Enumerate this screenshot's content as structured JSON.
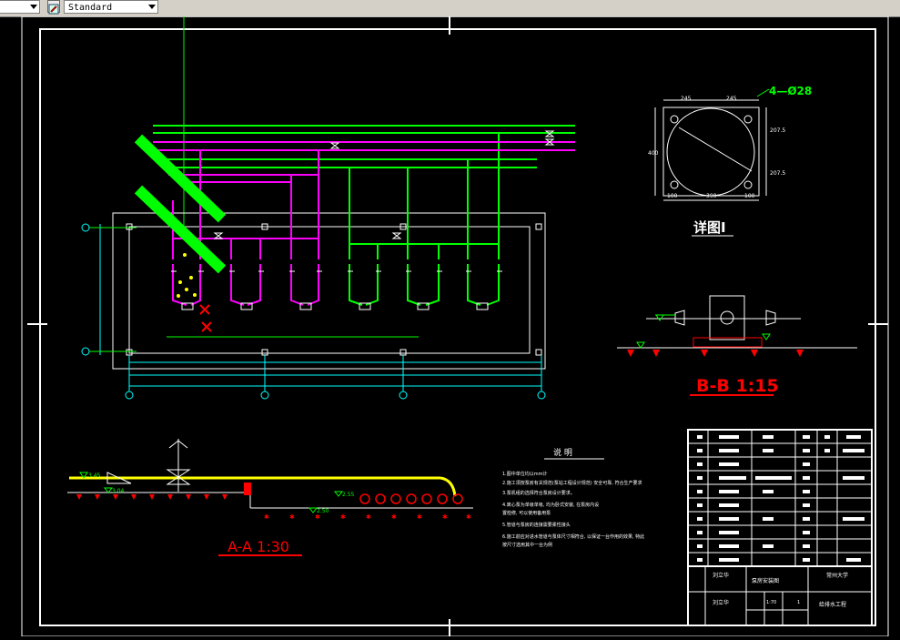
{
  "toolbar": {
    "layer_value": "",
    "text_style_value": "Standard"
  },
  "drawing": {
    "detail_title": "详图I",
    "detail_bolt_label": "4—Ø28",
    "detail_dims": {
      "top_left": "245",
      "top_right": "245",
      "right_top": "207.5",
      "right_bottom": "207.5",
      "bottom_left": "100",
      "bottom_mid": "390",
      "bottom_right": "100",
      "left_mid": "400"
    },
    "section_bb_title": "B-B 1:15",
    "section_aa_title": "A-A 1:30",
    "notes_title": "说 明",
    "aa_levels": [
      "3.45",
      "3.04",
      "2.55",
      "2.50"
    ],
    "notes": [
      "1.图中单位均以mm计",
      "2.施工须按泵房有关规范(泵站工程设计规范)  安全可靠, 符合生产要求",
      "3.泵机组的选择符合泵房设计要求。",
      "4.离心泵为单级单吸, 均为卧式安装, 在泵房内设",
      "  置检修, 可以使用备用泵",
      "5.管道与泵房的连接需要柔性接头",
      "6.施工前应对进水管道与泵体尺寸相符合, 以保证一台作用的效果, 特此",
      "  按尺寸选用其中一台为例"
    ],
    "title_block": {
      "designer": "刘立华",
      "checker": "刘立华",
      "drawing_name": "泵房安装图",
      "school": "常州大学",
      "scale": "1:70",
      "sheet": "1",
      "project": "给排水工程"
    }
  }
}
